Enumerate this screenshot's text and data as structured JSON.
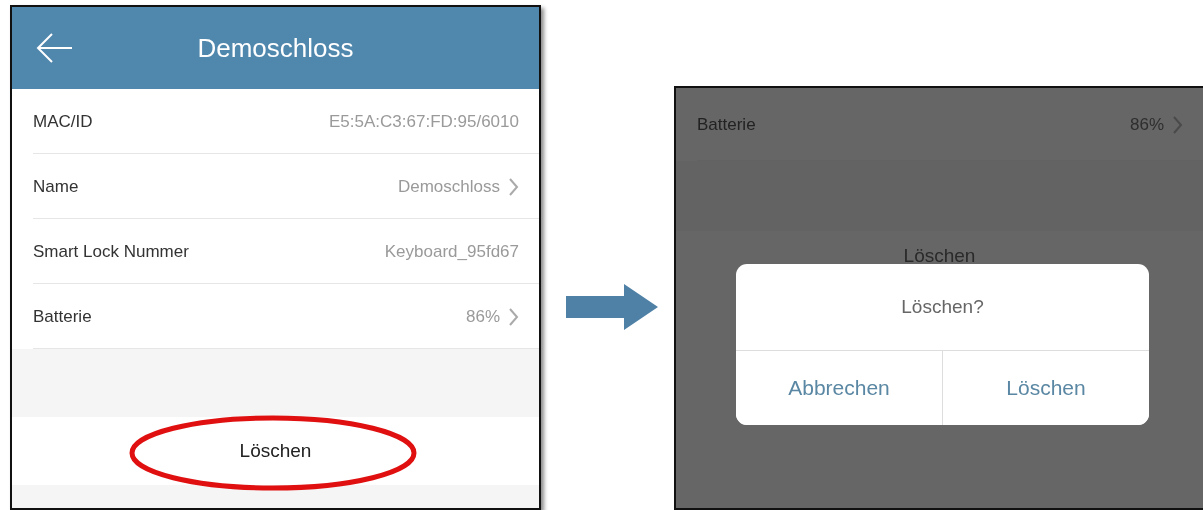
{
  "left_screen": {
    "header": {
      "title": "Demoschloss"
    },
    "rows": [
      {
        "label": "MAC/ID",
        "value": "E5:5A:C3:67:FD:95/6010",
        "chevron": false
      },
      {
        "label": "Name",
        "value": "Demoschloss",
        "chevron": true
      },
      {
        "label": "Smart Lock Nummer",
        "value": "Keyboard_95fd67",
        "chevron": false
      },
      {
        "label": "Batterie",
        "value": "86%",
        "chevron": true
      }
    ],
    "delete_button": {
      "label": "Löschen",
      "highlighted": true
    }
  },
  "right_screen": {
    "rows": [
      {
        "label": "Batterie",
        "value": "86%",
        "chevron": true
      }
    ],
    "delete_button": {
      "label": "Löschen"
    },
    "dialog": {
      "message": "Löschen?",
      "buttons": [
        {
          "label": "Abbrechen"
        },
        {
          "label": "Löschen"
        }
      ]
    }
  }
}
